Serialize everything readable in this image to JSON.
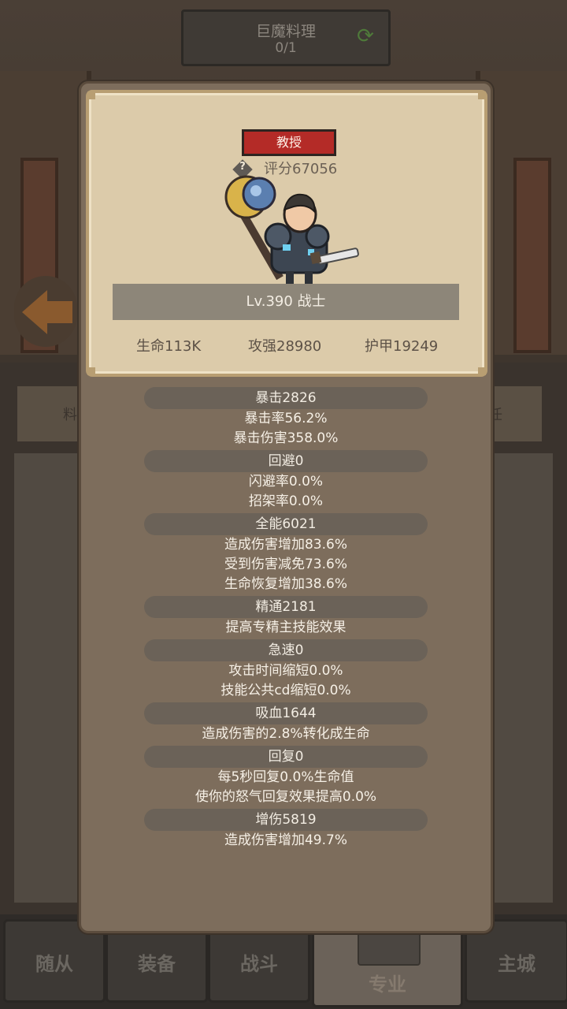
{
  "background": {
    "title": "巨魔料理",
    "counter": "0/1",
    "refresh_icon": "refresh-icon",
    "back_icon": "back-arrow-icon",
    "side_tab_left": "料",
    "side_tab_right": "任",
    "help_icon": "question-icon"
  },
  "bottom_nav": [
    {
      "label": "随从"
    },
    {
      "label": "装备"
    },
    {
      "label": "战斗"
    },
    {
      "label": "专业"
    },
    {
      "label": "主城"
    }
  ],
  "card": {
    "title_badge": "教授",
    "help_icon": "question-icon",
    "score": "评分67056",
    "level_label": "Lv.390 战士",
    "hp": "生命113K",
    "attack": "攻强28980",
    "armor": "护甲19249",
    "colors": {
      "badge": "#b42b27",
      "card": "#dccbaa",
      "dialog": "#7d6d5c"
    }
  },
  "stat_groups": [
    {
      "header": "暴击2826",
      "lines": [
        "暴击率56.2%",
        "暴击伤害358.0%"
      ]
    },
    {
      "header": "回避0",
      "lines": [
        "闪避率0.0%",
        "招架率0.0%"
      ]
    },
    {
      "header": "全能6021",
      "lines": [
        "造成伤害增加83.6%",
        "受到伤害减免73.6%",
        "生命恢复增加38.6%"
      ]
    },
    {
      "header": "精通2181",
      "lines": [
        "提高专精主技能效果"
      ]
    },
    {
      "header": "急速0",
      "lines": [
        "攻击时间缩短0.0%",
        "技能公共cd缩短0.0%"
      ]
    },
    {
      "header": "吸血1644",
      "lines": [
        "造成伤害的2.8%转化成生命"
      ]
    },
    {
      "header": "回复0",
      "lines": [
        "每5秒回复0.0%生命值",
        "使你的怒气回复效果提高0.0%"
      ]
    },
    {
      "header": "增伤5819",
      "lines": [
        "造成伤害增加49.7%"
      ]
    }
  ]
}
